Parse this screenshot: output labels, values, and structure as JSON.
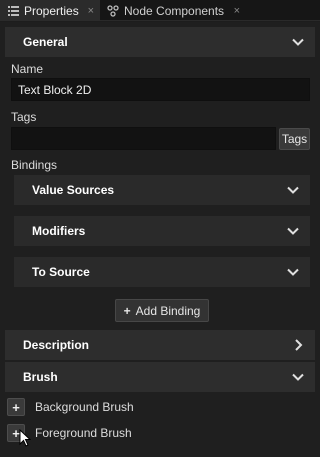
{
  "tabs": [
    {
      "label": "Properties",
      "icon": "list-icon",
      "close": "×"
    },
    {
      "label": "Node Components",
      "icon": "component-icon",
      "close": "×"
    }
  ],
  "general": {
    "title": "General",
    "name_label": "Name",
    "name_value": "Text Block 2D",
    "tags_label": "Tags",
    "tags_value": "",
    "tags_button": "Tags",
    "bindings_label": "Bindings",
    "binding_rows": [
      "Value Sources",
      "Modifiers",
      "To Source"
    ],
    "add_binding": "Add Binding"
  },
  "description": {
    "title": "Description"
  },
  "brush": {
    "title": "Brush",
    "items": [
      "Background Brush",
      "Foreground Brush"
    ]
  },
  "colors": {
    "background": "#1d1d1d",
    "section_header": "#2d2d2d",
    "field": "#121212"
  }
}
